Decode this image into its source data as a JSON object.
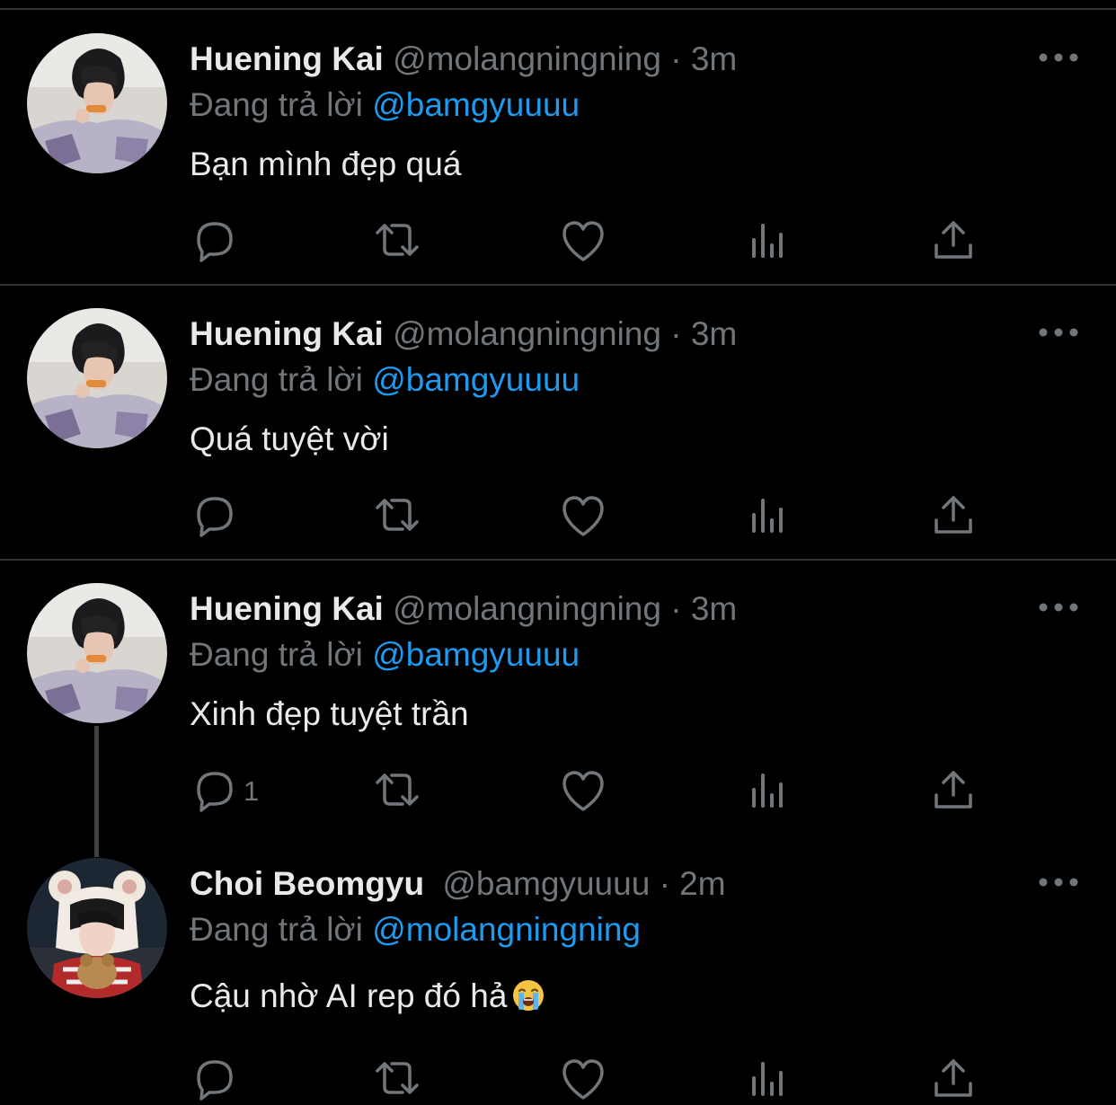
{
  "tweets": [
    {
      "display_name": "Huening Kai",
      "handle": "@molangningning",
      "dot": "·",
      "time": "3m",
      "reply_prefix": "Đang trả lời",
      "reply_to": "@bamgyuuuu",
      "text": "Bạn mình đẹp quá",
      "reply_count": "",
      "avatar_icon": "avatar-photo"
    },
    {
      "display_name": "Huening Kai",
      "handle": "@molangningning",
      "dot": "·",
      "time": "3m",
      "reply_prefix": "Đang trả lời",
      "reply_to": "@bamgyuuuu",
      "text": "Quá tuyệt vời",
      "reply_count": "",
      "avatar_icon": "avatar-photo"
    },
    {
      "display_name": "Huening Kai",
      "handle": "@molangningning",
      "dot": "·",
      "time": "3m",
      "reply_prefix": "Đang trả lời",
      "reply_to": "@bamgyuuuu",
      "text": "Xinh đẹp tuyệt trần",
      "reply_count": "1",
      "avatar_icon": "avatar-photo"
    },
    {
      "display_name": "Choi Beomgyu",
      "handle": "@bamgyuuuu",
      "dot": "·",
      "time": "2m",
      "reply_prefix": "Đang trả lời",
      "reply_to": "@molangningning",
      "text": "Cậu nhờ AI rep đó hả",
      "text_emoji": "loudly-crying-face-emoji",
      "reply_count": "",
      "avatar_icon": "avatar-photo"
    }
  ],
  "icons": {
    "more": "more-horizontal-icon",
    "reply": "reply-bubble-icon",
    "retweet": "retweet-icon",
    "like": "heart-icon",
    "views": "bar-chart-icon",
    "share": "share-upload-icon"
  },
  "colors": {
    "background": "#000000",
    "text": "#e7e9ea",
    "secondary": "#71767b",
    "accent": "#1d9bf0",
    "divider": "#2f3336"
  }
}
